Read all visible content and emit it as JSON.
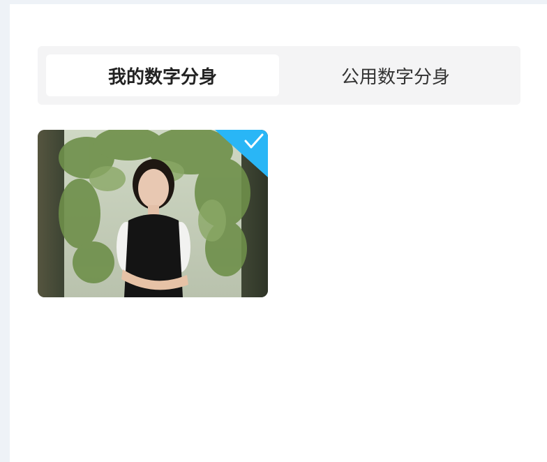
{
  "tabs": {
    "my_avatars": "我的数字分身",
    "public_avatars": "公用数字分身"
  },
  "selection_badge": {
    "icon": "check-icon",
    "color": "#29b6f6"
  },
  "avatars": [
    {
      "selected": true
    }
  ]
}
